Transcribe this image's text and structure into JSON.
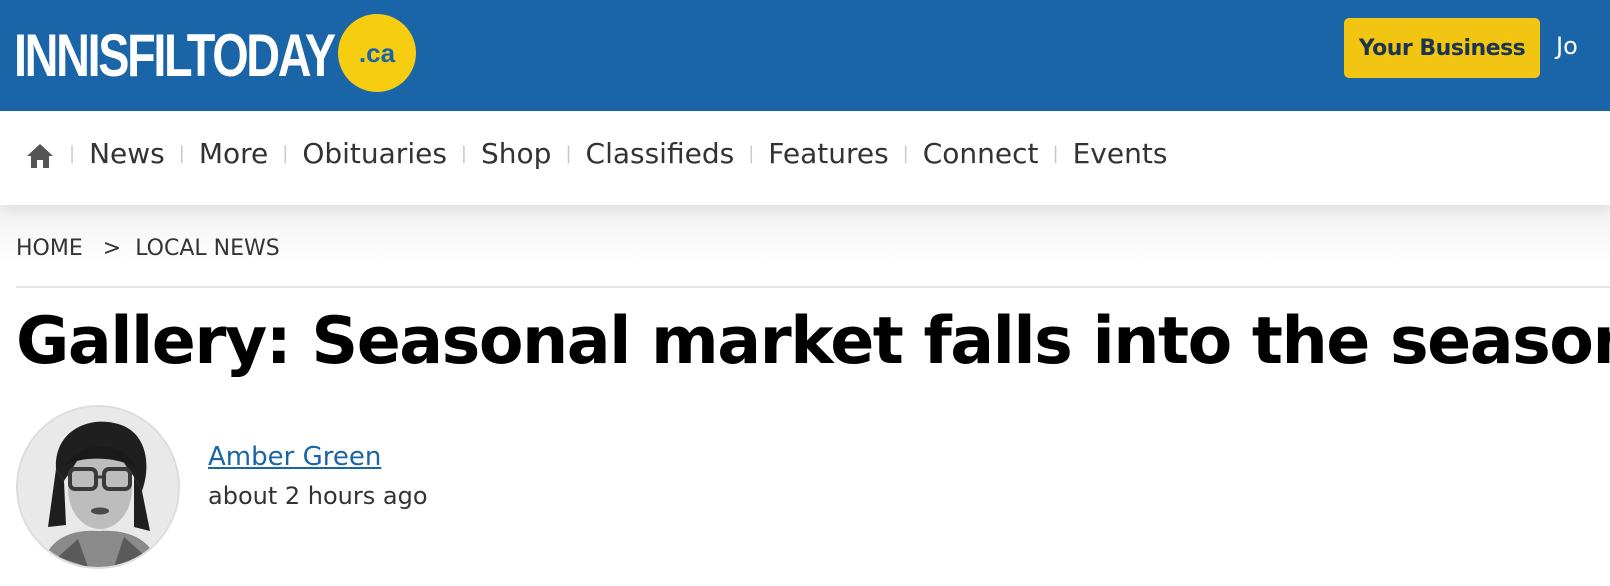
{
  "header": {
    "logo_text": "INNISFILTODAY",
    "logo_badge": ".ca",
    "your_business_label": "Your Business",
    "cut_off_text": "Jo",
    "bg_color": "#1a64a8",
    "accent_color": "#f2c512"
  },
  "nav": {
    "home_icon": "home-icon",
    "items": [
      {
        "label": "News"
      },
      {
        "label": "More"
      },
      {
        "label": "Obituaries"
      },
      {
        "label": "Shop"
      },
      {
        "label": "Classifieds"
      },
      {
        "label": "Features"
      },
      {
        "label": "Connect"
      },
      {
        "label": "Events"
      }
    ]
  },
  "breadcrumb": {
    "home": "HOME",
    "separator": ">",
    "section": "LOCAL NEWS"
  },
  "article": {
    "headline": "Gallery: Seasonal market falls into the season",
    "author_name": "Amber Green",
    "timestamp": "about 2 hours ago"
  }
}
